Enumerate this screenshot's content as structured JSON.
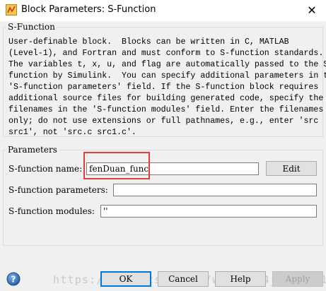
{
  "window": {
    "title": "Block Parameters: S-Function",
    "close_glyph": "✕"
  },
  "sfunction_group": {
    "label": "S-Function",
    "description": "User-definable block.  Blocks can be written in C, MATLAB\n(Level-1), and Fortran and must conform to S-function standards.\nThe variables t, x, u, and flag are automatically passed to the S-\nfunction by Simulink.  You can specify additional parameters in the\n'S-function parameters' field. If the S-function block requires\nadditional source files for building generated code, specify the\nfilenames in the 'S-function modules' field. Enter the filenames\nonly; do not use extensions or full pathnames, e.g., enter 'src\nsrc1', not 'src.c src1.c'."
  },
  "parameters_group": {
    "label": "Parameters",
    "name_label": "S-function name:",
    "name_value": "fenDuan_func",
    "edit_label": "Edit",
    "params_label": "S-function parameters:",
    "params_value": "",
    "modules_label": "S-function modules:",
    "modules_value": "''"
  },
  "footer": {
    "ok_label": "OK",
    "cancel_label": "Cancel",
    "help_label": "Help",
    "apply_label": "Apply",
    "watermark": "https://blog.csdn.net/weixin_4__609581"
  },
  "colors": {
    "highlight": "#e03c3c",
    "accent": "#0078d7"
  },
  "icons": {
    "app": "simulink-block-icon",
    "help": "help-question-icon",
    "close": "close-icon"
  }
}
